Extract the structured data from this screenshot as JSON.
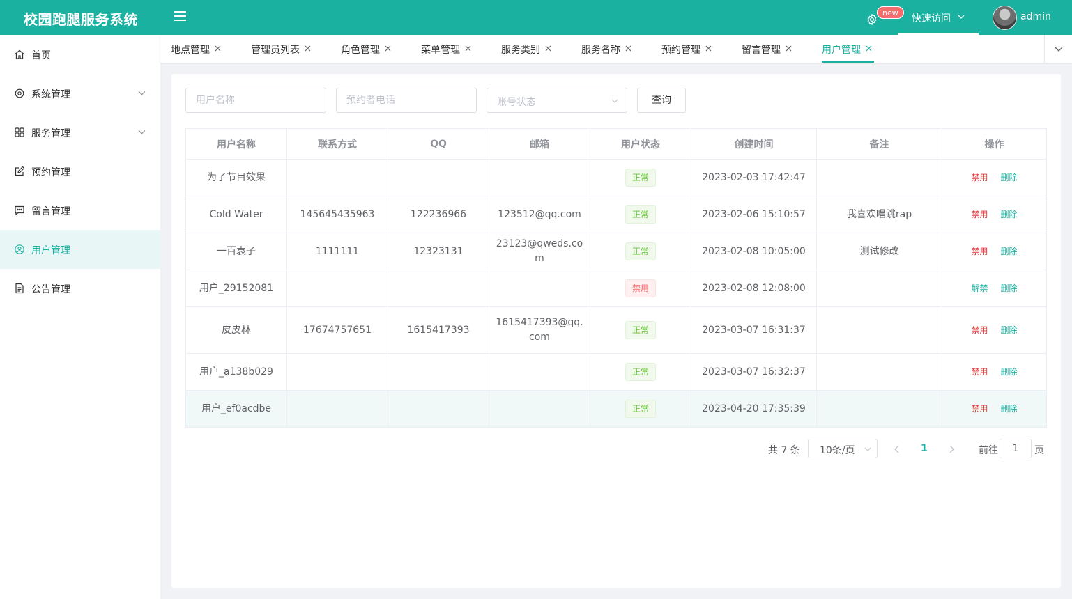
{
  "header": {
    "title": "校园跑腿服务系统",
    "new_badge": "new",
    "quick_access": "快速访问",
    "username": "admin"
  },
  "sidebar": {
    "items": [
      {
        "label": "首页",
        "icon": "home-icon"
      },
      {
        "label": "系统管理",
        "icon": "gear-icon"
      },
      {
        "label": "服务管理",
        "icon": "grid-icon"
      },
      {
        "label": "预约管理",
        "icon": "edit-icon"
      },
      {
        "label": "留言管理",
        "icon": "message-icon"
      },
      {
        "label": "用户管理",
        "icon": "user-icon"
      },
      {
        "label": "公告管理",
        "icon": "document-icon"
      }
    ]
  },
  "tabs": [
    "地点管理",
    "管理员列表",
    "角色管理",
    "菜单管理",
    "服务类别",
    "服务名称",
    "预约管理",
    "留言管理",
    "用户管理"
  ],
  "filters": {
    "username_placeholder": "用户名称",
    "phone_placeholder": "预约者电话",
    "status_placeholder": "账号状态",
    "query_label": "查询"
  },
  "table": {
    "headers": [
      "用户名称",
      "联系方式",
      "QQ",
      "邮箱",
      "用户状态",
      "创建时间",
      "备注",
      "操作"
    ],
    "rows": [
      {
        "name": "为了节目效果",
        "phone": "",
        "qq": "",
        "email": "",
        "status": "正常",
        "created": "2023-02-03 17:42:47",
        "note": "",
        "action1": "禁用",
        "action2": "删除"
      },
      {
        "name": "Cold Water",
        "phone": "145645435963",
        "qq": "122236966",
        "email": "123512@qq.com",
        "status": "正常",
        "created": "2023-02-06 15:10:57",
        "note": "我喜欢唱跳rap",
        "action1": "禁用",
        "action2": "删除"
      },
      {
        "name": "一百袁子",
        "phone": "1111111",
        "qq": "12323131",
        "email": "23123@qweds.com",
        "status": "正常",
        "created": "2023-02-08 10:05:00",
        "note": "测试修改",
        "action1": "禁用",
        "action2": "删除"
      },
      {
        "name": "用户_29152081",
        "phone": "",
        "qq": "",
        "email": "",
        "status": "禁用",
        "created": "2023-02-08 12:08:00",
        "note": "",
        "action1": "解禁",
        "action2": "删除"
      },
      {
        "name": "皮皮林",
        "phone": "17674757651",
        "qq": "1615417393",
        "email": "1615417393@qq.com",
        "status": "正常",
        "created": "2023-03-07 16:31:37",
        "note": "",
        "action1": "禁用",
        "action2": "删除"
      },
      {
        "name": "用户_a138b029",
        "phone": "",
        "qq": "",
        "email": "",
        "status": "正常",
        "created": "2023-03-07 16:32:37",
        "note": "",
        "action1": "禁用",
        "action2": "删除"
      },
      {
        "name": "用户_ef0acdbe",
        "phone": "",
        "qq": "",
        "email": "",
        "status": "正常",
        "created": "2023-04-20 17:35:39",
        "note": "",
        "action1": "禁用",
        "action2": "删除"
      }
    ]
  },
  "pagination": {
    "total": "共 7 条",
    "page_size": "10条/页",
    "current_page": "1",
    "goto_label": "前往",
    "goto_value": "1",
    "page_suffix": "页"
  },
  "colors": {
    "brand": "#1bb1a1",
    "danger": "#e4393c",
    "success": "#67c23a"
  }
}
